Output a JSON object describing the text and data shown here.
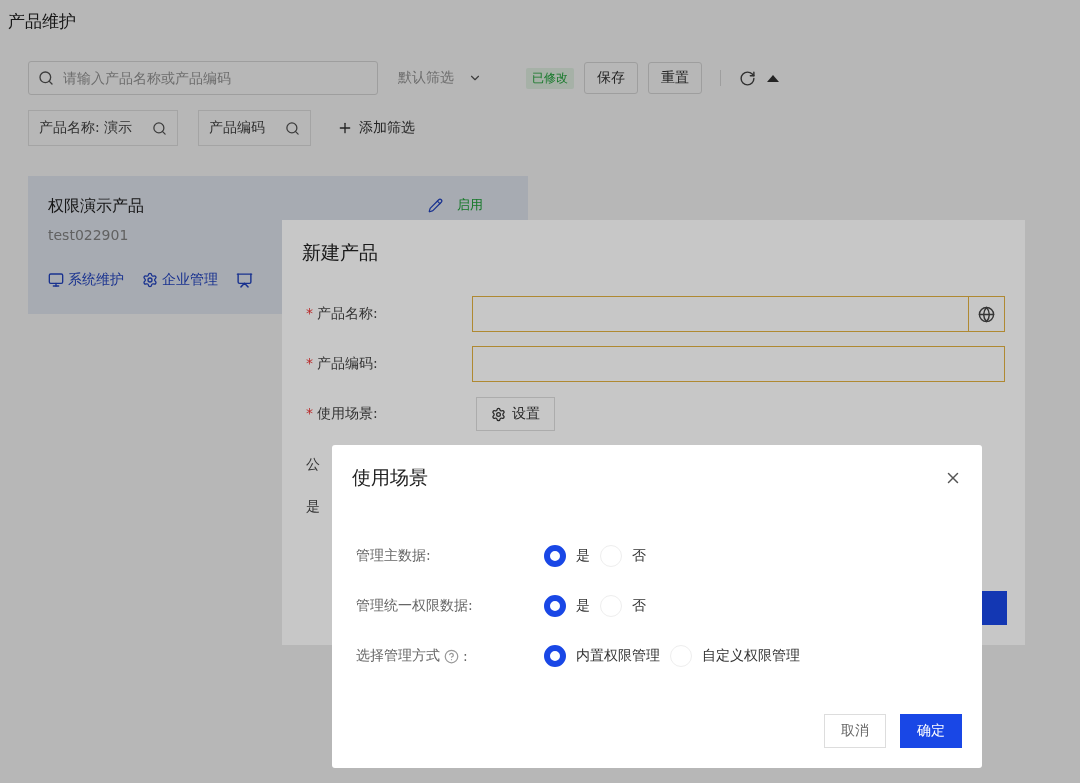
{
  "page": {
    "title": "产品维护"
  },
  "toolbar": {
    "search": {
      "placeholder": "请输入产品名称或产品编码"
    },
    "filter_select": "默认筛选",
    "modified_tag": "已修改",
    "buttons": [
      "保存",
      "重置"
    ]
  },
  "filters": [
    {
      "kind": "field",
      "label": "产品名称:",
      "value": "演示"
    },
    {
      "kind": "field",
      "label": "产品编码"
    },
    {
      "kind": "add",
      "label": "添加筛选"
    }
  ],
  "product_card": {
    "name": "权限演示产品",
    "code": "test022901",
    "status": "启用",
    "links": [
      "系统维护",
      "企业管理"
    ]
  },
  "create_dialog": {
    "title": "新建产品",
    "fields": [
      {
        "kind": "input-lang",
        "label": "产品名称:",
        "marker": "*"
      },
      {
        "kind": "input",
        "label": "产品编码:",
        "marker": "*"
      },
      {
        "kind": "button",
        "label": "使用场景:",
        "marker": "*",
        "button": "设置"
      }
    ],
    "hidden_labels": [
      "公",
      "是"
    ]
  },
  "scene_dialog": {
    "title": "使用场景",
    "rows": [
      {
        "label": "管理主数据:",
        "help": false,
        "options": [
          {
            "label": "是",
            "selected": true
          },
          {
            "label": "否",
            "selected": false
          }
        ]
      },
      {
        "label": "管理统一权限数据:",
        "help": false,
        "options": [
          {
            "label": "是",
            "selected": true
          },
          {
            "label": "否",
            "selected": false
          }
        ]
      },
      {
        "label": "选择管理方式",
        "help": true,
        "help_suffix": ":",
        "options": [
          {
            "label": "内置权限管理",
            "selected": true
          },
          {
            "label": "自定义权限管理",
            "selected": false
          }
        ]
      }
    ],
    "buttons": [
      {
        "label": "取消",
        "primary": false
      },
      {
        "label": "确定",
        "primary": true
      }
    ]
  }
}
